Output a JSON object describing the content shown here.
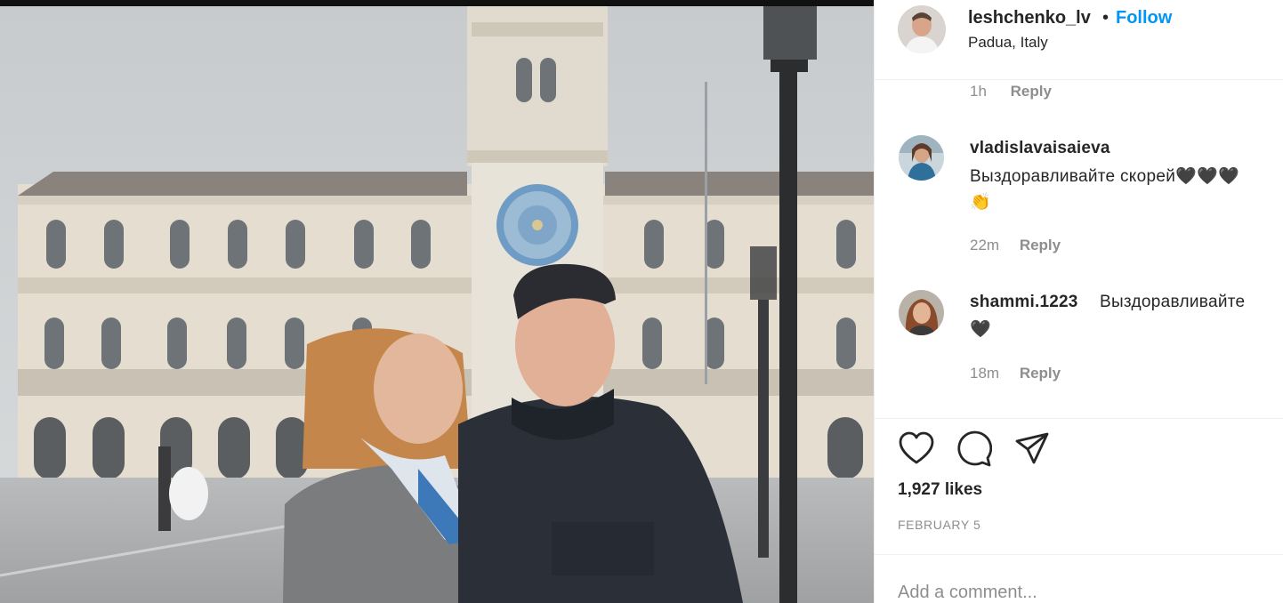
{
  "post": {
    "username": "leshchenko_lv",
    "separator": "•",
    "follow_label": "Follow",
    "location": "Padua, Italy"
  },
  "first_meta": {
    "time": "1h",
    "reply": "Reply"
  },
  "comments": [
    {
      "username": "vladislavaisaieva",
      "text": "Выздоравливайте скорей🖤🖤🖤",
      "text2": "👏",
      "time": "22m",
      "reply": "Reply"
    },
    {
      "username": "shammi.1223",
      "text": "Выздоравливайте",
      "text2": "🖤",
      "time": "18m",
      "reply": "Reply"
    }
  ],
  "actions": {
    "like_icon": "heart-icon",
    "comment_icon": "comment-icon",
    "share_icon": "share-icon"
  },
  "likes": "1,927 likes",
  "date": "FEBRUARY 5",
  "add_comment_placeholder": "Add a comment...",
  "colors": {
    "follow": "#0095f6",
    "muted": "#8e8e8e",
    "text": "#262626"
  }
}
